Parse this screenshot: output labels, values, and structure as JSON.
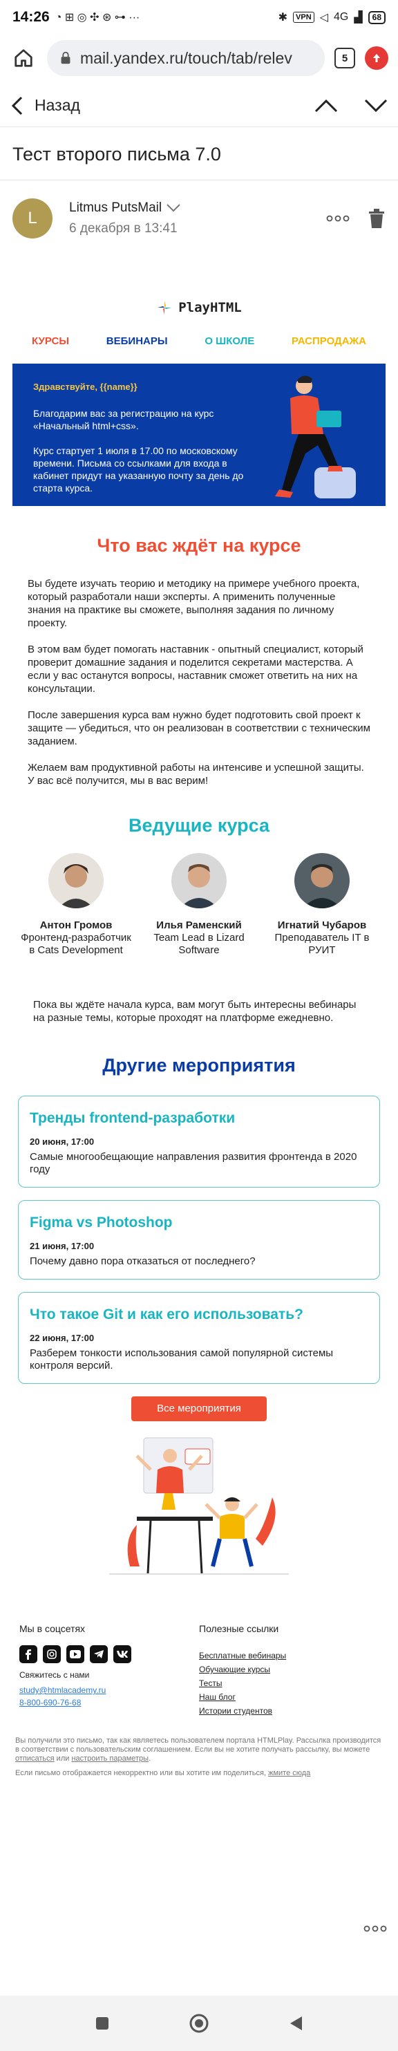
{
  "status": {
    "time": "14:26",
    "vpn": "VPN",
    "network": "4G",
    "battery": "68"
  },
  "browser": {
    "url": "mail.yandex.ru/touch/tab/relev",
    "tabs_count": "5"
  },
  "mailnav": {
    "back_label": "Назад"
  },
  "subject": "Тест второго письма 7.0",
  "sender": {
    "initial": "L",
    "name": "Litmus PutsMail",
    "date": "6 декабря в 13:41"
  },
  "email": {
    "logo_text": "PlayHTML",
    "menu": [
      {
        "label": "КУРСЫ",
        "color": "#ee4e34"
      },
      {
        "label": "ВЕБИНАРЫ",
        "color": "#0a3ca5"
      },
      {
        "label": "О ШКОЛЕ",
        "color": "#19b5c2"
      },
      {
        "label": "РАСПРОДАЖА",
        "color": "#f5b700"
      }
    ],
    "hero": {
      "greeting": "Здравствуйте, {{name}}",
      "p1": "Благодарим вас за регистрацию на курс «Начальный html+css».",
      "p2": "Курс стартует 1 июля в 17.00 по московскому времени. Письма со ссылками для входа в кабинет придут на указанную почту за день до старта курса."
    },
    "what_title": "Что вас ждёт на курсе",
    "paragraphs": [
      "Вы будете изучать теорию и методику на примере учебного проекта, который разработали наши эксперты. А применить полученные знания на практике вы сможете, выполняя задания по личному проекту.",
      "В этом вам будет помогать наставник - опытный специалист, который проверит домашние задания и поделится секретами мастерства. А если у вас останутся вопросы, наставник сможет ответить на них на консультации.",
      "После завершения курса вам нужно будет подготовить свой проект к защите — убедиться, что он реализован в соответствии с техническим заданием.",
      "Желаем вам продуктивной работы на интенсиве и успешной защиты. У вас всё получится, мы в вас верим!"
    ],
    "teachers_title": "Ведущие курса",
    "teachers": [
      {
        "name": "Антон Громов",
        "role": "Фронтенд-разработчик в Cats Development"
      },
      {
        "name": "Илья Раменский",
        "role": "Team Lead в Lizard Software"
      },
      {
        "name": "Игнатий Чубаров",
        "role": "Преподаватель IT в РУИТ"
      }
    ],
    "note": "Пока вы ждёте начала курса, вам могут быть интересны вебинары на разные темы, которые проходят на платформе ежедневно.",
    "events_title": "Другие мероприятия",
    "events": [
      {
        "title": "Тренды frontend-разработки",
        "date": "20 июня, 17:00",
        "desc": "Самые многообещающие направления развития фронтенда в 2020 году"
      },
      {
        "title": "Figma vs Photoshop",
        "date": "21 июня, 17:00",
        "desc": "Почему давно пора отказаться от последнего?"
      },
      {
        "title": "Что такое Git и как его использовать?",
        "date": "22 июня, 17:00",
        "desc": "Разберем тонкости использования самой популярной системы контроля версий."
      }
    ],
    "all_events_label": "Все мероприятия",
    "footer": {
      "social_title": "Мы в соцсетях",
      "contact_title": "Свяжитесь с нами",
      "email": "study@htmlacademy.ru",
      "phone": "8-800-690-76-68",
      "links_title": "Полезные ссылки",
      "links": [
        "Бесплатные вебинары",
        "Обучающие курсы",
        "Тесты",
        "Наш блог",
        "Истории студентов"
      ]
    },
    "legal": {
      "l1": "Вы получили это письмо, так как являетесь пользователем портала HTMLPlay. Рассылка производится в соответствии с пользовательским соглашением. Если вы не хотите получать рассылку, вы можете ",
      "unsub": "отписаться",
      "or": " или ",
      "settings": "настроить параметры",
      "dot": ".",
      "l2": "Если письмо отображается некорректно или вы хотите им поделиться, ",
      "view": "жмите сюда"
    }
  },
  "colors": {
    "accent_red": "#ee4e34",
    "navy": "#0a3ca5",
    "teal": "#19b5c2",
    "yellow": "#f5b700"
  }
}
